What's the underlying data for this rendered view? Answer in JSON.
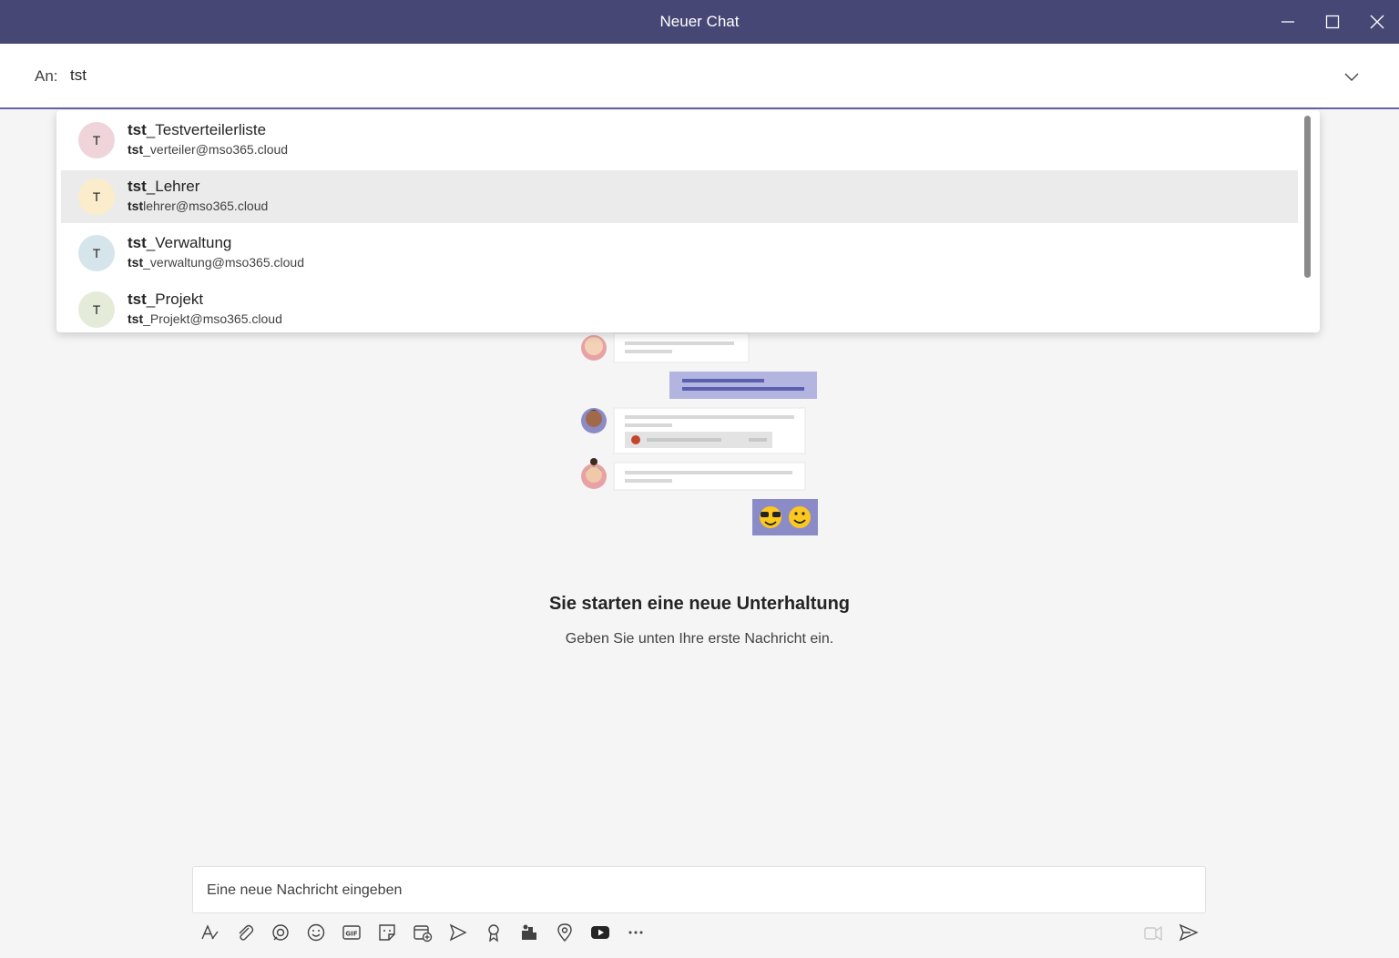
{
  "window": {
    "title": "Neuer Chat",
    "icons": {
      "minimize": "minimize-icon",
      "maximize": "maximize-icon",
      "close": "close-icon"
    }
  },
  "to": {
    "label": "An:",
    "value": "tst",
    "chevron_icon": "chevron-down-icon"
  },
  "suggestions": [
    {
      "initial": "T",
      "name_bold": "tst",
      "name_rest": "_Testverteilerliste",
      "mail_bold": "tst",
      "mail_rest": "_verteiler@mso365.cloud",
      "avatar_bg": "#efd5da",
      "avatar_fg": "#242424"
    },
    {
      "initial": "T",
      "name_bold": "tst",
      "name_rest": "_Lehrer",
      "mail_bold": "tst",
      "mail_rest": "lehrer@mso365.cloud",
      "avatar_bg": "#fbeccb",
      "avatar_fg": "#242424"
    },
    {
      "initial": "T",
      "name_bold": "tst",
      "name_rest": "_Verwaltung",
      "mail_bold": "tst",
      "mail_rest": "_verwaltung@mso365.cloud",
      "avatar_bg": "#d6e4ec",
      "avatar_fg": "#242424"
    },
    {
      "initial": "T",
      "name_bold": "tst",
      "name_rest": "_Projekt",
      "mail_bold": "tst",
      "mail_rest": "_Projekt@mso365.cloud",
      "avatar_bg": "#e4ecd9",
      "avatar_fg": "#242424"
    }
  ],
  "empty_state": {
    "title": "Sie starten eine neue Unterhaltung",
    "subtitle": "Geben Sie unten Ihre erste Nachricht ein."
  },
  "compose": {
    "placeholder": "Eine neue Nachricht eingeben"
  },
  "toolbar": {
    "items": [
      "format-icon",
      "attach-icon",
      "loop-icon",
      "emoji-icon",
      "gif-icon",
      "sticker-icon",
      "meeting-icon",
      "stream-icon",
      "praise-icon",
      "apps-icon",
      "location-icon",
      "video-icon",
      "more-icon"
    ],
    "right": [
      "dictate-icon",
      "send-icon"
    ]
  },
  "colors": {
    "titlebar": "#464775",
    "accent": "#6264a7",
    "hover_row": "#ebebeb",
    "page_bg": "#f5f5f5"
  }
}
